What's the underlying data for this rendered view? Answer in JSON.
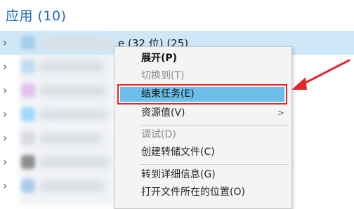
{
  "section": {
    "title": "应用 (10)"
  },
  "app_rows": [
    {
      "name_tail": "e (32 位) (25)",
      "selected": true,
      "icon_color": "#9ecbe8"
    },
    {
      "name_tail": "",
      "selected": false,
      "icon_color": "#b9d9f2"
    },
    {
      "name_tail": "",
      "selected": false,
      "icon_color": "#e2b7ec"
    },
    {
      "name_tail": "",
      "selected": false,
      "icon_color": "#8fd6ff"
    },
    {
      "name_tail": "",
      "selected": false,
      "icon_color": "#d7d7e0"
    },
    {
      "name_tail": "",
      "selected": false,
      "icon_color": "#7b7b7b"
    },
    {
      "name_tail": "",
      "selected": false,
      "icon_color": "#9fc5ea"
    },
    {
      "name_tail": "",
      "selected": false,
      "icon_color": "#cfe0f0"
    }
  ],
  "context_menu": {
    "items": [
      {
        "label": "展开(P)"
      },
      {
        "label": "切换到(T)"
      },
      {
        "label": "结束任务(E)"
      },
      {
        "label": "资源值(V)",
        "submenu_arrow": ">"
      },
      {
        "label": "调试(D)"
      },
      {
        "label": "创建转储文件(C)"
      },
      {
        "label": "转到详细信息(G)"
      },
      {
        "label": "打开文件所在的位置(O)"
      }
    ]
  },
  "colors": {
    "accent_blue": "#1e67c4",
    "selection": "#cfe8f7",
    "menu_highlight": "#6bbfe9",
    "annotation_red": "#e8262a"
  }
}
